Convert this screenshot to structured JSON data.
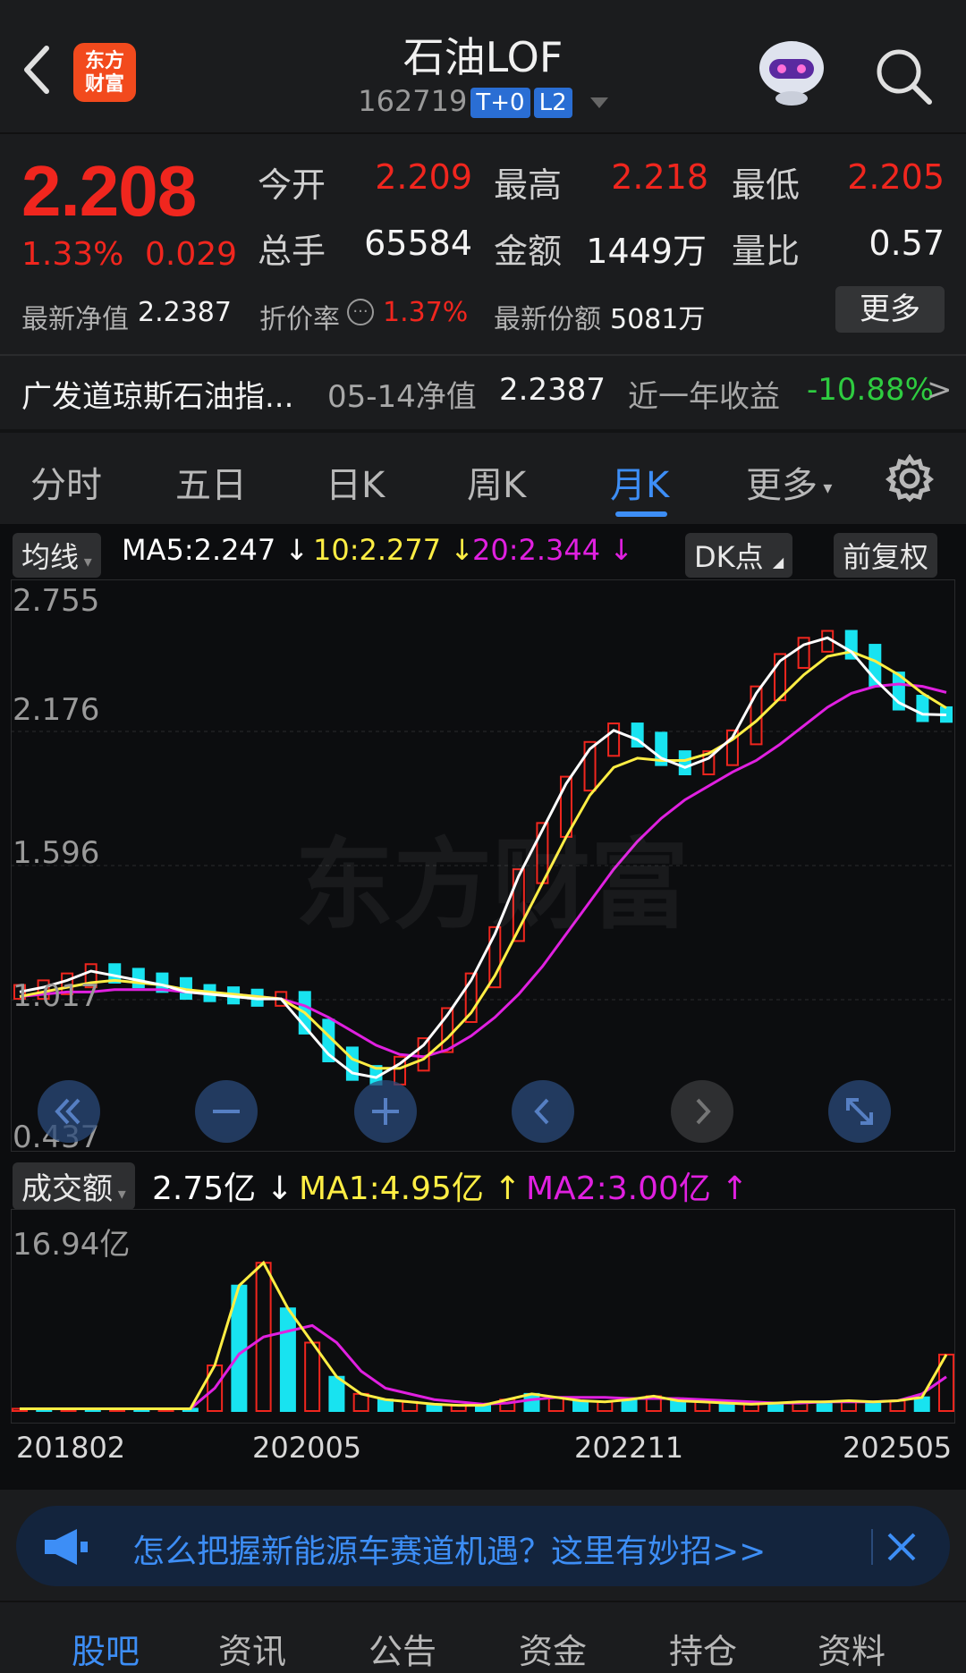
{
  "header": {
    "logo_line1": "东方",
    "logo_line2": "财富",
    "title": "石油LOF",
    "code": "162719",
    "tag_t0": "T+0",
    "tag_l2": "L2"
  },
  "quote": {
    "price": "2.208",
    "change_pct": "1.33%",
    "change_abs": "0.029",
    "open_label": "今开",
    "open_value": "2.209",
    "high_label": "最高",
    "high_value": "2.218",
    "low_label": "最低",
    "low_value": "2.205",
    "vol_label": "总手",
    "vol_value": "65584",
    "amt_label": "金额",
    "amt_value": "1449万",
    "ratio_label": "量比",
    "ratio_value": "0.57",
    "nav_label": "最新净值",
    "nav_value": "2.2387",
    "discount_label": "折价率",
    "discount_value": "1.37%",
    "share_label": "最新份额",
    "share_value": "5081万",
    "more_button": "更多"
  },
  "fund_row": {
    "name": "广发道琼斯石油指...",
    "nav_label": "05-14净值",
    "nav_value": "2.2387",
    "return_label": "近一年收益",
    "return_value": "-10.88%",
    "arrow": ">"
  },
  "tabs": [
    "分时",
    "五日",
    "日K",
    "周K",
    "月K",
    "更多"
  ],
  "active_tab": "月K",
  "ma_bar": {
    "selector": "均线",
    "ma5": "MA5:2.247",
    "ma10": "10:2.277",
    "ma20": "20:2.344",
    "dk_button": "DK点",
    "adjust_button": "前复权"
  },
  "volume_bar": {
    "selector": "成交额",
    "value": "2.75亿",
    "ma1": "MA1:4.95亿",
    "ma2": "MA2:3.00亿",
    "max_label": "16.94亿"
  },
  "colors": {
    "up": "#f0261e",
    "down": "#18e3f0",
    "ma5": "#ffffff",
    "ma10": "#ffee44",
    "ma20": "#e020e0",
    "accent": "#3d8ef6",
    "green": "#2ecc40"
  },
  "chart_data": {
    "type": "candlestick",
    "y_ticks": [
      "2.755",
      "2.176",
      "1.596",
      "1.017",
      "0.437"
    ],
    "ylim": [
      0.437,
      2.755
    ],
    "x_ticks": [
      "201802",
      "202005",
      "202211",
      "202505"
    ],
    "ma5": [
      1.05,
      1.07,
      1.1,
      1.14,
      1.12,
      1.1,
      1.08,
      1.05,
      1.04,
      1.03,
      1.02,
      1.02,
      0.9,
      0.78,
      0.7,
      0.68,
      0.74,
      0.82,
      0.95,
      1.1,
      1.3,
      1.55,
      1.75,
      1.95,
      2.1,
      2.18,
      2.14,
      2.06,
      2.02,
      2.06,
      2.15,
      2.34,
      2.48,
      2.55,
      2.58,
      2.52,
      2.4,
      2.3,
      2.25,
      2.247
    ],
    "ma10": [
      1.03,
      1.05,
      1.07,
      1.09,
      1.1,
      1.09,
      1.08,
      1.06,
      1.05,
      1.04,
      1.03,
      1.02,
      0.96,
      0.86,
      0.76,
      0.72,
      0.72,
      0.76,
      0.85,
      0.96,
      1.12,
      1.32,
      1.52,
      1.72,
      1.9,
      2.02,
      2.06,
      2.05,
      2.05,
      2.08,
      2.14,
      2.22,
      2.32,
      2.42,
      2.5,
      2.52,
      2.48,
      2.42,
      2.34,
      2.277
    ],
    "ma20": [
      1.03,
      1.04,
      1.05,
      1.05,
      1.06,
      1.06,
      1.06,
      1.05,
      1.04,
      1.04,
      1.03,
      1.02,
      0.99,
      0.94,
      0.88,
      0.82,
      0.78,
      0.77,
      0.8,
      0.86,
      0.94,
      1.04,
      1.16,
      1.3,
      1.44,
      1.58,
      1.7,
      1.8,
      1.88,
      1.94,
      2.0,
      2.05,
      2.12,
      2.2,
      2.28,
      2.34,
      2.37,
      2.38,
      2.37,
      2.344
    ],
    "volume_ma1": [
      0.2,
      0.2,
      0.2,
      0.2,
      0.2,
      0.2,
      0.2,
      0.2,
      4,
      11,
      13,
      9,
      6,
      3,
      1.5,
      1,
      0.8,
      0.6,
      0.5,
      0.5,
      1,
      1.5,
      1.2,
      0.9,
      0.8,
      1,
      1.3,
      0.9,
      0.8,
      0.7,
      0.6,
      0.7,
      0.8,
      0.8,
      0.9,
      0.8,
      0.9,
      1.2,
      4.95
    ],
    "volume_ma2": [
      0.2,
      0.2,
      0.2,
      0.2,
      0.2,
      0.2,
      0.2,
      0.2,
      2,
      5,
      6.5,
      7,
      7.5,
      6,
      3.5,
      2,
      1.5,
      1,
      0.8,
      0.6,
      0.7,
      1,
      1.2,
      1.2,
      1.2,
      1.1,
      1.1,
      1.1,
      1,
      0.9,
      0.8,
      0.7,
      0.7,
      0.8,
      0.8,
      0.8,
      0.9,
      1.5,
      3.0
    ]
  },
  "banner": {
    "text": "怎么把握新能源车赛道机遇？这里有妙招>>"
  },
  "bottom_tabs": [
    "股吧",
    "资讯",
    "公告",
    "资金",
    "持仓",
    "资料"
  ],
  "watermark": "东方财富"
}
